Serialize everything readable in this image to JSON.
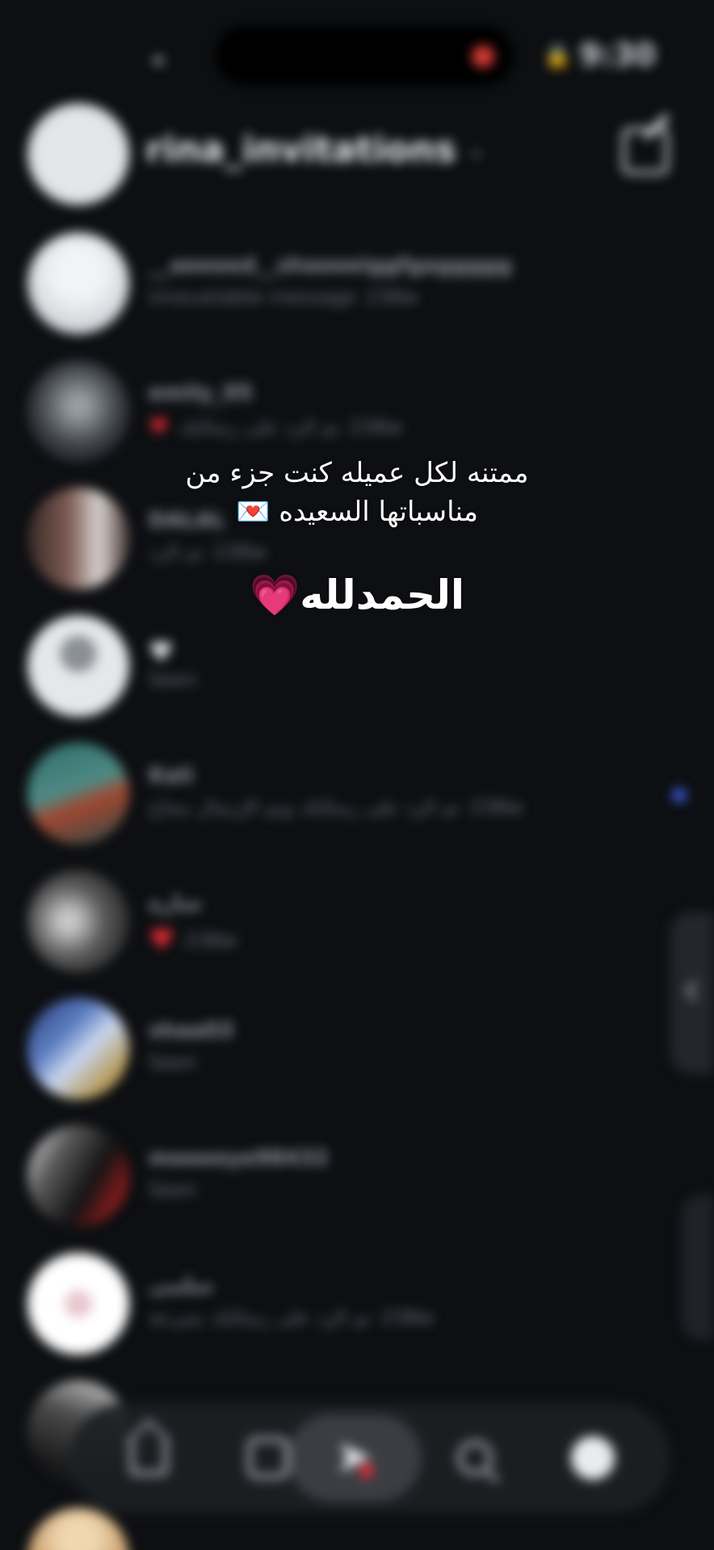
{
  "status_bar": {
    "time": "9:30",
    "lock_icon": "lock-icon"
  },
  "header": {
    "username": "rina_invitations",
    "dropdown_icon": "chevron-down-icon",
    "compose_icon": "compose-icon"
  },
  "conversations": [
    {
      "name": "__aeeeed__shaeeeiggfgaggggg",
      "message": "Unavailable message",
      "time": "238w"
    },
    {
      "name": "emily_05",
      "message": "تم الرد على رسالتك",
      "time": "238w",
      "heart": "♥"
    },
    {
      "name": "DALAL",
      "message": "تم الرد",
      "time": "238w"
    },
    {
      "name": "♥",
      "message": "Seen",
      "time": ""
    },
    {
      "name": "Kali",
      "message": "تم الرد على رسالتك وتم الإرسال بنجاح",
      "time": "238w",
      "unread": true
    },
    {
      "name": "سارة",
      "message": "",
      "time": "238w",
      "heart": "♥"
    },
    {
      "name": "shaa03",
      "message": "Seen",
      "time": ""
    },
    {
      "name": "meeeeye98432",
      "message": "Seen",
      "time": ""
    },
    {
      "name": "سلمى",
      "message": "تم الرد على رسالتك بسرعة",
      "time": "238w"
    }
  ],
  "overlay": {
    "line1": "ممتنه لكل عميله كنت جزء من",
    "line2": "مناسباتها السعيده 💌",
    "line3": "الحمدلله💗"
  },
  "nav": {
    "items": [
      {
        "icon": "home-icon"
      },
      {
        "icon": "reels-icon"
      },
      {
        "icon": "messages-icon"
      },
      {
        "icon": "search-icon"
      },
      {
        "icon": "profile-icon"
      }
    ],
    "active": "messages-icon"
  },
  "colors": {
    "background": "#0d0f12",
    "accent_red": "#e02b34",
    "unread_blue": "#3b5bdb"
  }
}
